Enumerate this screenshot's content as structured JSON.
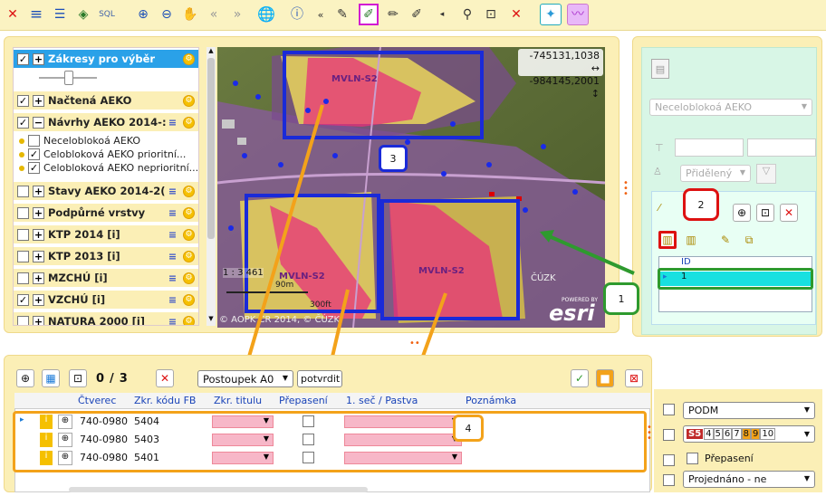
{
  "toolbar": {
    "icons": [
      "close-icon",
      "list-icon",
      "legend-icon",
      "layers-icon",
      "sql-icon",
      "zoom-in-icon",
      "zoom-out-icon",
      "pan-icon",
      "back-icon",
      "forward-icon",
      "globe-icon",
      "info-icon",
      "collapse-icon",
      "edit-icon",
      "draw-icon",
      "pencil-icon",
      "eraser-icon",
      "arrow-icon",
      "pin-icon",
      "box-icon",
      "delete-icon",
      "magic-icon",
      "brush-icon"
    ],
    "sql_label": "SQL"
  },
  "layers": {
    "top": {
      "label": "Zákresy pro výběr",
      "checked": "✓"
    },
    "items": [
      {
        "label": "Načtená AEKO",
        "checked": "✓",
        "expand": "+"
      },
      {
        "label": "Návrhy AEKO 2014-:",
        "checked": "✓",
        "expand": "−"
      },
      {
        "label": "Stavy AEKO 2014-2(",
        "checked": "",
        "expand": "+"
      },
      {
        "label": "Podpůrné vrstvy",
        "checked": "",
        "expand": "+"
      },
      {
        "label": "KTP 2014 [i]",
        "checked": "",
        "expand": "+"
      },
      {
        "label": "KTP 2013 [i]",
        "checked": "",
        "expand": "+"
      },
      {
        "label": "MZCHÚ [i]",
        "checked": "",
        "expand": "+"
      },
      {
        "label": "VZCHÚ [i]",
        "checked": "✓",
        "expand": "+"
      },
      {
        "label": "NATURA 2000 [i]",
        "checked": "",
        "expand": "+"
      }
    ],
    "subitems": [
      {
        "label": "Neceloblokoá AEKO",
        "checked": ""
      },
      {
        "label": "Celobloková AEKO prioritní...",
        "checked": "✓"
      },
      {
        "label": "Celobloková AEKO neprioritní...",
        "checked": "✓"
      }
    ]
  },
  "map": {
    "coord_x": "-745131,1038 ↔",
    "coord_y": "-984145,2001 ↕",
    "labels": [
      "MVLN-S2",
      "MVLN-S2",
      "MVLN-S2"
    ],
    "scale_text": "1 : 3 461",
    "scale_m": "90m",
    "scale_ft": "300ft",
    "copyright": "© AOPK ČR 2014, © ČÚZK",
    "cuzk": "ČÚZK",
    "esri_powered": "POWERED BY",
    "esri": "esri"
  },
  "rightpanel": {
    "dropdown1": "Neceloblokoá AEKO",
    "dropdown2": "Přidělený",
    "grid_header": "ID",
    "grid_value": "1"
  },
  "bottom": {
    "counter_current": "0",
    "counter_sep": "/",
    "counter_total": "3",
    "postup_select": "Postoupek A0",
    "potvrdit": "potvrdit",
    "columns": [
      "Čtverec",
      "Zkr. kódu FB",
      "Zkr. titulu",
      "Přepasení",
      "1. seč / Pastva",
      "Poznámka"
    ],
    "rows": [
      {
        "ctverec": "740-0980",
        "kod": "5404"
      },
      {
        "ctverec": "740-0980",
        "kod": "5403"
      },
      {
        "ctverec": "740-0980",
        "kod": "5401"
      }
    ]
  },
  "bottomright": {
    "podm": "PODM",
    "s5": "S5",
    "nums": [
      "4",
      "5",
      "6",
      "7",
      "8",
      "9",
      "10"
    ],
    "prepaseni": "Přepasení",
    "projednano": "Projednáno - ne"
  },
  "callouts": {
    "c1": "1",
    "c2": "2",
    "c3": "3",
    "c4": "4"
  },
  "colors": {
    "accent": "#f3a21a",
    "blue": "#1a2ad8",
    "green": "#2e9a2e",
    "panel": "#fbefb6"
  }
}
